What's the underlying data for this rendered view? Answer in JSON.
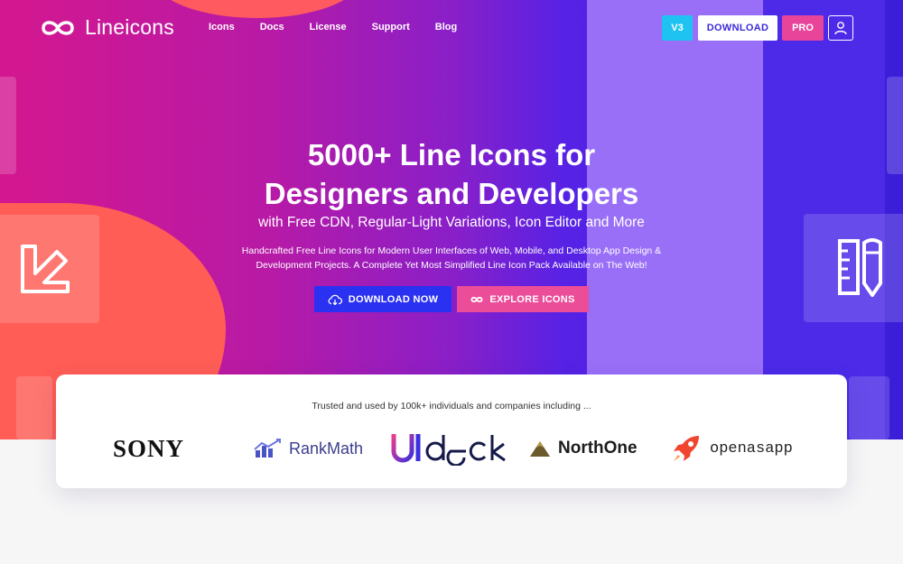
{
  "brand": {
    "name": "Lineicons",
    "logo_icon": "infinity-icon"
  },
  "nav": {
    "links": [
      "Icons",
      "Docs",
      "License",
      "Support",
      "Blog"
    ]
  },
  "header_actions": {
    "version_label": "V3",
    "download_label": "DOWNLOAD",
    "pro_label": "PRO",
    "user_icon": "user-icon"
  },
  "hero": {
    "title_line1": "5000+ Line Icons for",
    "title_line2": "Designers and Developers",
    "subtitle": "with Free CDN, Regular-Light Variations, Icon Editor and More",
    "description_line1": "Handcrafted Free Line Icons for Modern User Interfaces of Web, Mobile, and Desktop App Design &",
    "description_line2": "Development Projects. A Complete Yet Most Simplified Line Icon Pack Available on The Web!",
    "cta_primary": "DOWNLOAD NOW",
    "cta_primary_icon": "cloud-download-icon",
    "cta_secondary": "EXPLORE ICONS",
    "cta_secondary_icon": "infinity-icon"
  },
  "trust": {
    "text": "Trusted and used by 100k+ individuals and companies including ...",
    "logos": {
      "sony": "SONY",
      "rankmath": "RankMath",
      "uideck": "UIdeck",
      "northone": "NorthOne",
      "openasapp": "openasapp"
    }
  },
  "colors": {
    "hero_pink": "#d4178f",
    "hero_purple": "#8a1fc8",
    "hero_blue": "#4a2cf0",
    "coral": "#ff5d56",
    "cta_blue": "#2b31f0",
    "cta_pink": "#eb4d99",
    "version_cyan": "#1ec3f2"
  }
}
